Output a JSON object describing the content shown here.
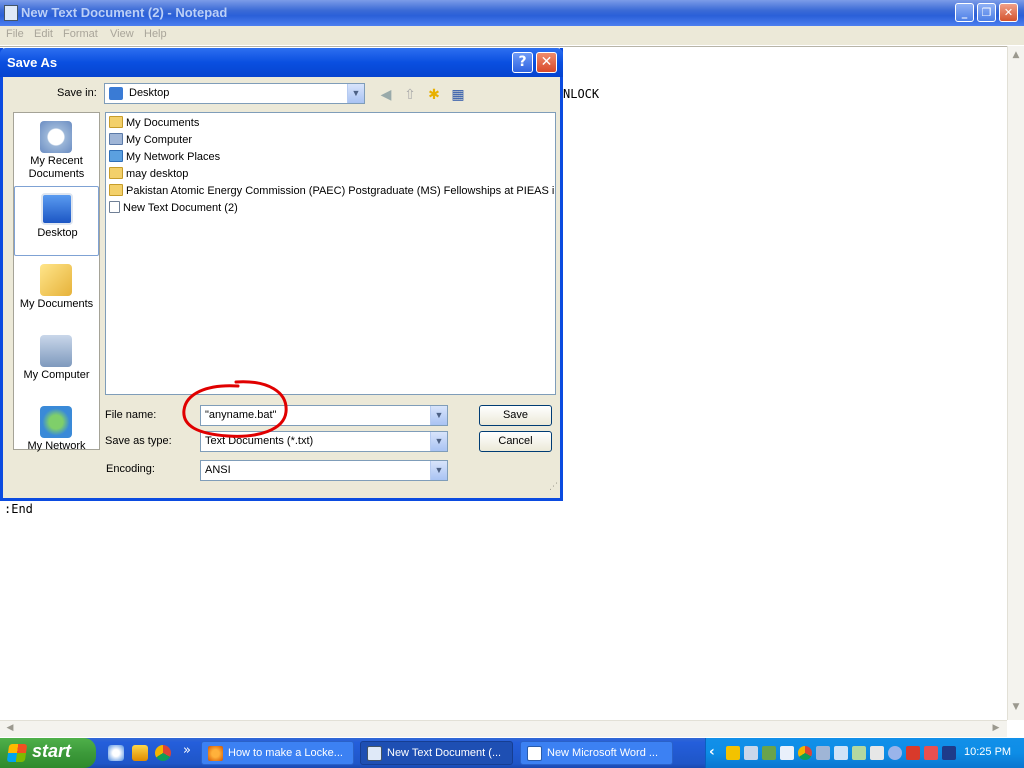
{
  "notepad": {
    "title": "New Text Document (2) - Notepad",
    "menu": [
      "File",
      "Edit",
      "Format",
      "View",
      "Help"
    ],
    "content_visible": [
      "NLOCK",
      ":End"
    ],
    "caption_buttons": {
      "minimize": "_",
      "maximize": "❐",
      "close": "✕"
    }
  },
  "dialog": {
    "title": "Save As",
    "help_glyph": "?",
    "close_glyph": "✕",
    "save_in_label": "Save in:",
    "save_in_value": "Desktop",
    "places": [
      {
        "label": "My Recent Documents",
        "icon": "recent-documents-icon"
      },
      {
        "label": "Desktop",
        "icon": "desktop-icon"
      },
      {
        "label": "My Documents",
        "icon": "my-documents-icon"
      },
      {
        "label": "My Computer",
        "icon": "my-computer-icon"
      },
      {
        "label": "My Network",
        "icon": "my-network-icon"
      }
    ],
    "files": [
      {
        "name": "My Documents",
        "icon": "folder-icon"
      },
      {
        "name": "My Computer",
        "icon": "computer-icon"
      },
      {
        "name": "My Network Places",
        "icon": "network-icon"
      },
      {
        "name": "may desktop",
        "icon": "folder-icon"
      },
      {
        "name": "Pakistan Atomic Energy Commission (PAEC) Postgraduate (MS) Fellowships at PIEAS in Isl",
        "icon": "folder-icon"
      },
      {
        "name": "New Text Document (2)",
        "icon": "text-file-icon"
      }
    ],
    "file_name_label": "File name:",
    "file_name_value": "\"anyname.bat\"",
    "save_as_type_label": "Save as type:",
    "save_as_type_value": "Text Documents (*.txt)",
    "encoding_label": "Encoding:",
    "encoding_value": "ANSI",
    "save_button": "Save",
    "cancel_button": "Cancel",
    "annotation_color": "#e00000"
  },
  "taskbar": {
    "start_label": "start",
    "overflow": "»",
    "tasks": [
      {
        "label": "How to make a Locke...",
        "active": false
      },
      {
        "label": "New Text Document (...",
        "active": true
      },
      {
        "label": "New Microsoft Word ...",
        "active": false
      }
    ],
    "tray_expand": "‹",
    "clock": "10:25 PM"
  },
  "colors": {
    "xp_blue": "#0a4fe0",
    "dialog_bg": "#ece9d8",
    "start_green": "#3c9a3a",
    "tray_blue": "#0d8de6"
  }
}
